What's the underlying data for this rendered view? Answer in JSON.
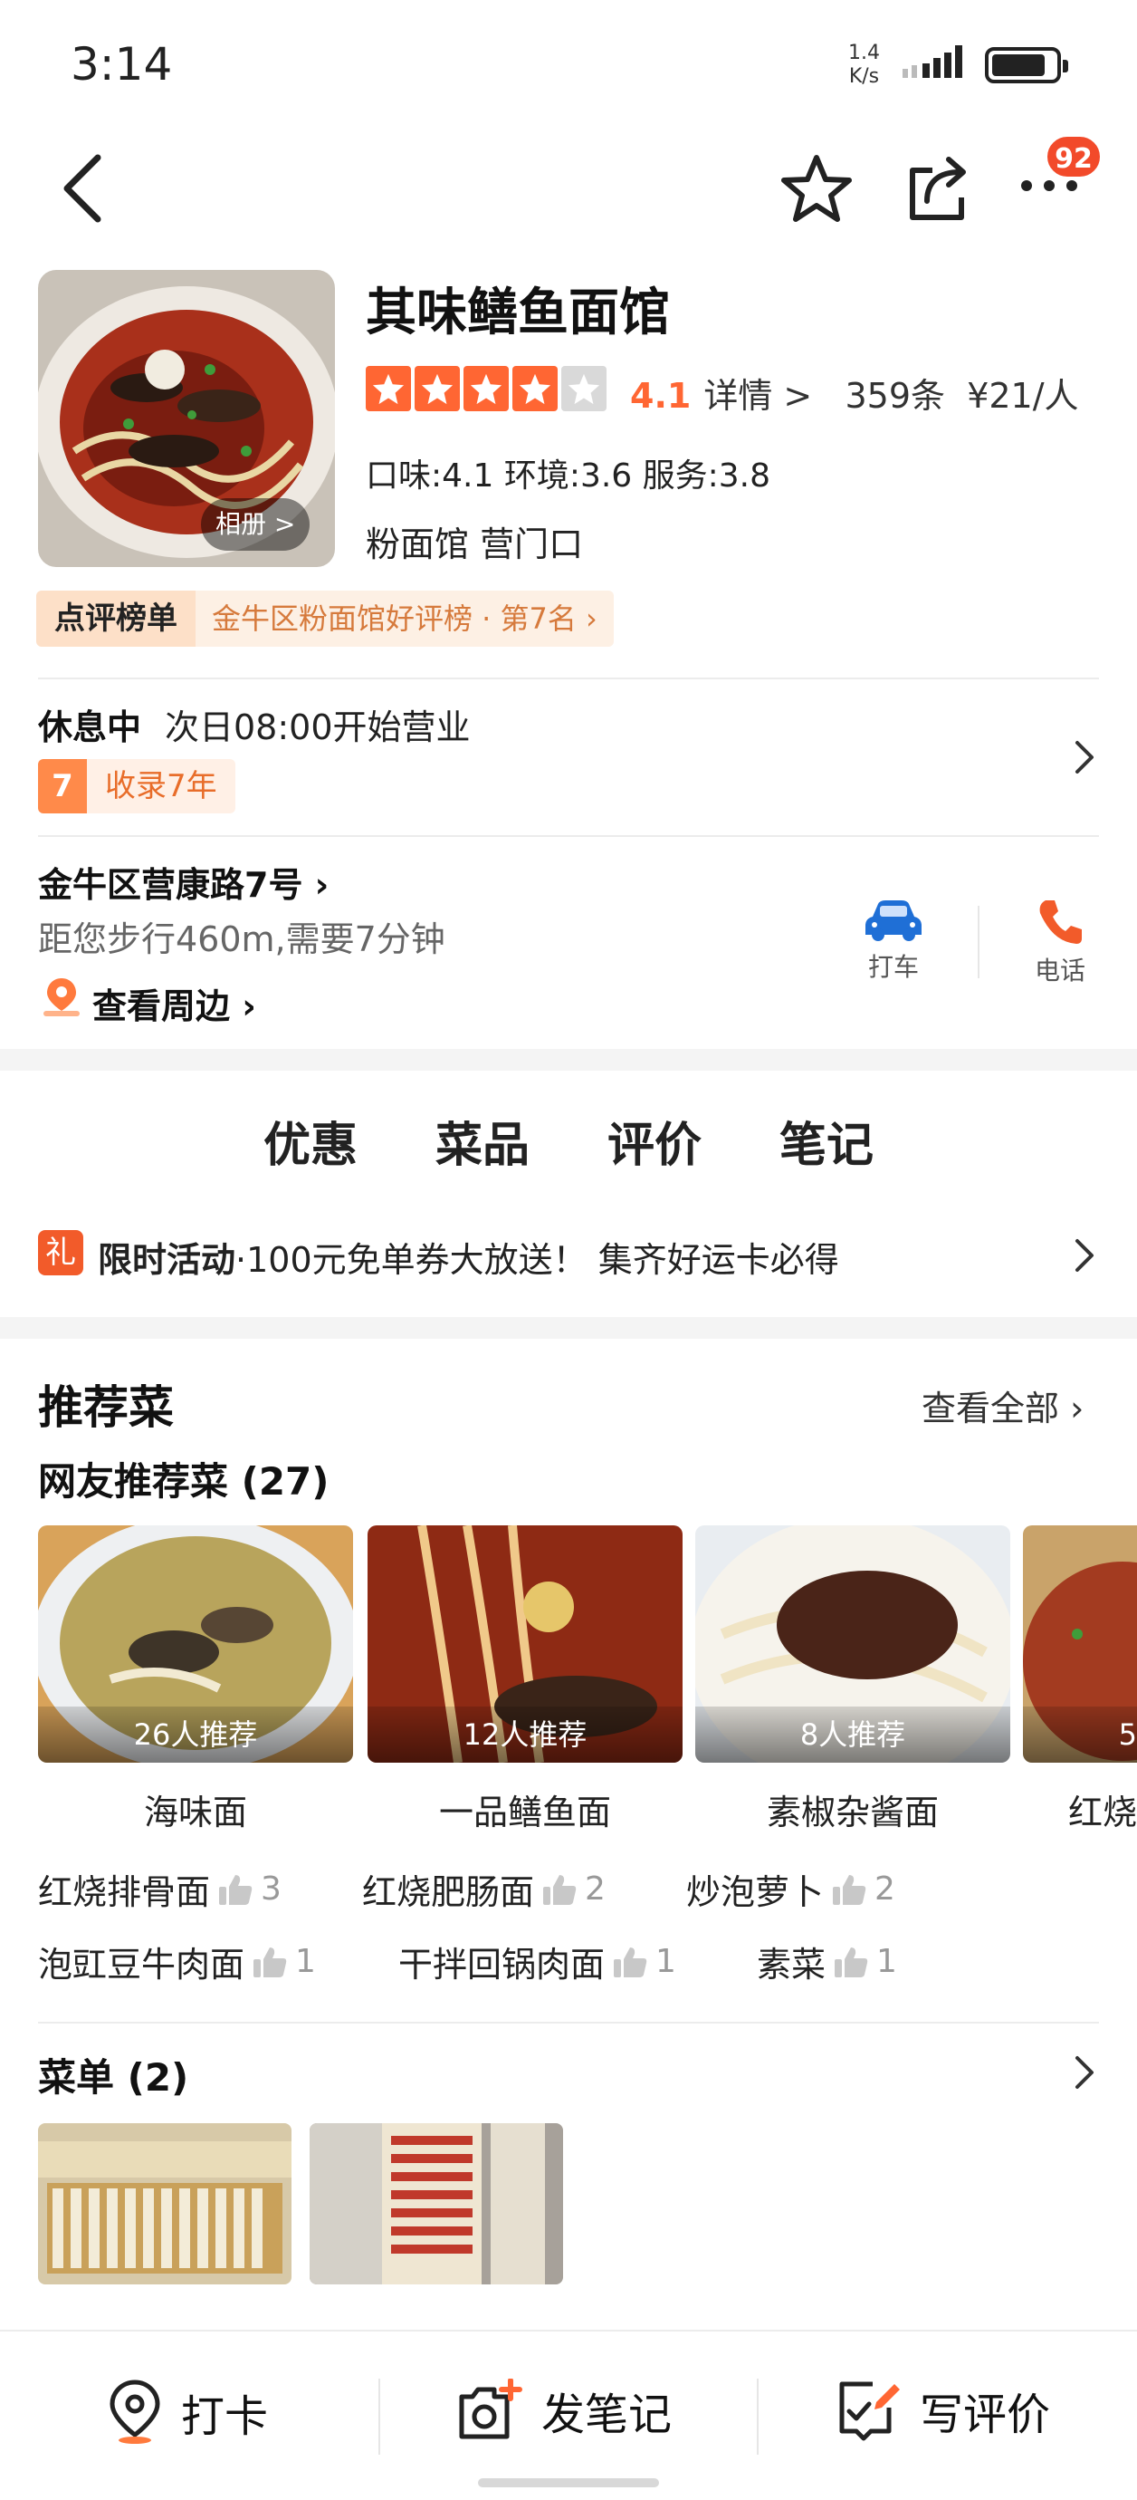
{
  "status_bar": {
    "time": "3:14",
    "net_speed_value": "1.4",
    "net_speed_unit": "K/s"
  },
  "nav": {
    "notification_count": "92"
  },
  "shop": {
    "name": "其味鳝鱼面馆",
    "album_label": "相册 >",
    "rating": "4.1",
    "rating_fraction": 0.82,
    "details_label": "详情 >",
    "review_count": "359条",
    "price": "¥21/人",
    "scores": "口味:4.1  环境:3.6  服务:3.8",
    "category": "粉面馆  营门口"
  },
  "rank": {
    "tag": "点评榜单",
    "text": "金牛区粉面馆好评榜 · 第7名 ›"
  },
  "hours": {
    "status": "休息中",
    "text": "次日08:00开始营业",
    "years_num": "7",
    "years_text": "收录7年"
  },
  "location": {
    "address": "金牛区营康路7号 ›",
    "distance": "距您步行460m,需要7分钟",
    "nearby": "查看周边 ›",
    "taxi_label": "打车",
    "phone_label": "电话"
  },
  "tabs": [
    {
      "label": "优惠"
    },
    {
      "label": "菜品"
    },
    {
      "label": "评价"
    },
    {
      "label": "笔记"
    }
  ],
  "promo": {
    "icon_text": "礼",
    "title": "限时活动",
    "text": "·100元免单券大放送！ 集齐好运卡必得"
  },
  "recommend": {
    "title": "推荐菜",
    "see_all": "查看全部 ›",
    "subtitle": "网友推荐菜 (27)",
    "dishes": [
      {
        "name": "海味面",
        "recommend": "26人推荐"
      },
      {
        "name": "一品鳝鱼面",
        "recommend": "12人推荐"
      },
      {
        "name": "素椒杂酱面",
        "recommend": "8人推荐"
      },
      {
        "name": "红烧",
        "recommend": "5"
      }
    ],
    "more_dishes": [
      {
        "name": "红烧排骨面",
        "count": "3"
      },
      {
        "name": "红烧肥肠面",
        "count": "2"
      },
      {
        "name": "炒泡萝卜",
        "count": "2"
      },
      {
        "name": "泡豇豆牛肉面",
        "count": "1"
      },
      {
        "name": "干拌回锅肉面",
        "count": "1"
      },
      {
        "name": "素菜",
        "count": "1"
      }
    ]
  },
  "menu": {
    "title": "菜单 (2)"
  },
  "bottom_bar": {
    "checkin": "打卡",
    "post_note": "发笔记",
    "write_review": "写评价"
  },
  "colors": {
    "accent": "#ff6633",
    "promo_red": "#f25b2a",
    "rank_text": "#d67a3c"
  }
}
